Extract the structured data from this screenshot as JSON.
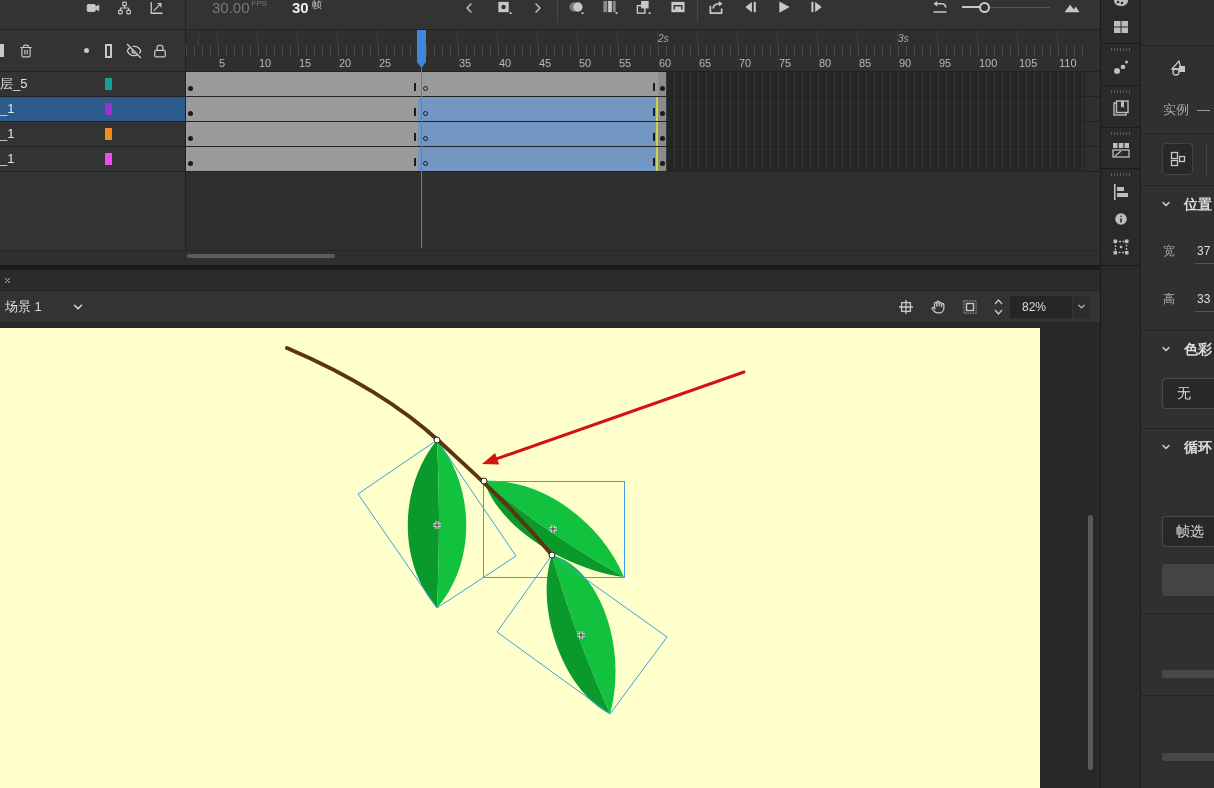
{
  "timeline_toolbar": {
    "fps": "30.00",
    "fps_unit": "FPS",
    "frame": "30",
    "frame_unit": "帧",
    "zoom": {
      "level": 0.25
    }
  },
  "ruler": {
    "seconds": [
      "2s",
      "3s"
    ],
    "frames_before_playhead": [
      "5",
      "10",
      "15",
      "20",
      "25"
    ],
    "frames_after_playhead": [
      "35",
      "40",
      "45",
      "50",
      "55",
      "60",
      "65",
      "70",
      "75",
      "80",
      "85",
      "90",
      "95",
      "100",
      "105",
      "110"
    ]
  },
  "layers": [
    {
      "name": "层_5",
      "color": "#13a197",
      "selected": false,
      "tweened": false
    },
    {
      "name": "_1",
      "color": "#9a33c9",
      "selected": true,
      "tweened": true
    },
    {
      "name": "_1",
      "color": "#f28c1b",
      "selected": false,
      "tweened": true
    },
    {
      "name": "_1",
      "color": "#ea4fe6",
      "selected": false,
      "tweened": true
    }
  ],
  "scene_bar": {
    "scene": "场景 1",
    "zoom": "82%"
  },
  "properties": {
    "instance": {
      "label": "实例",
      "value": "—"
    },
    "sections": [
      {
        "kind": "fields",
        "title": "位置",
        "expanded": true,
        "fields": [
          {
            "label": "宽",
            "value": "37"
          },
          {
            "label": "高",
            "value": "33"
          }
        ]
      },
      {
        "kind": "dropdown",
        "title": "色彩",
        "expanded": true,
        "value": "无"
      },
      {
        "kind": "loop",
        "title": "循环",
        "expanded": true,
        "value": "帧选"
      }
    ]
  }
}
